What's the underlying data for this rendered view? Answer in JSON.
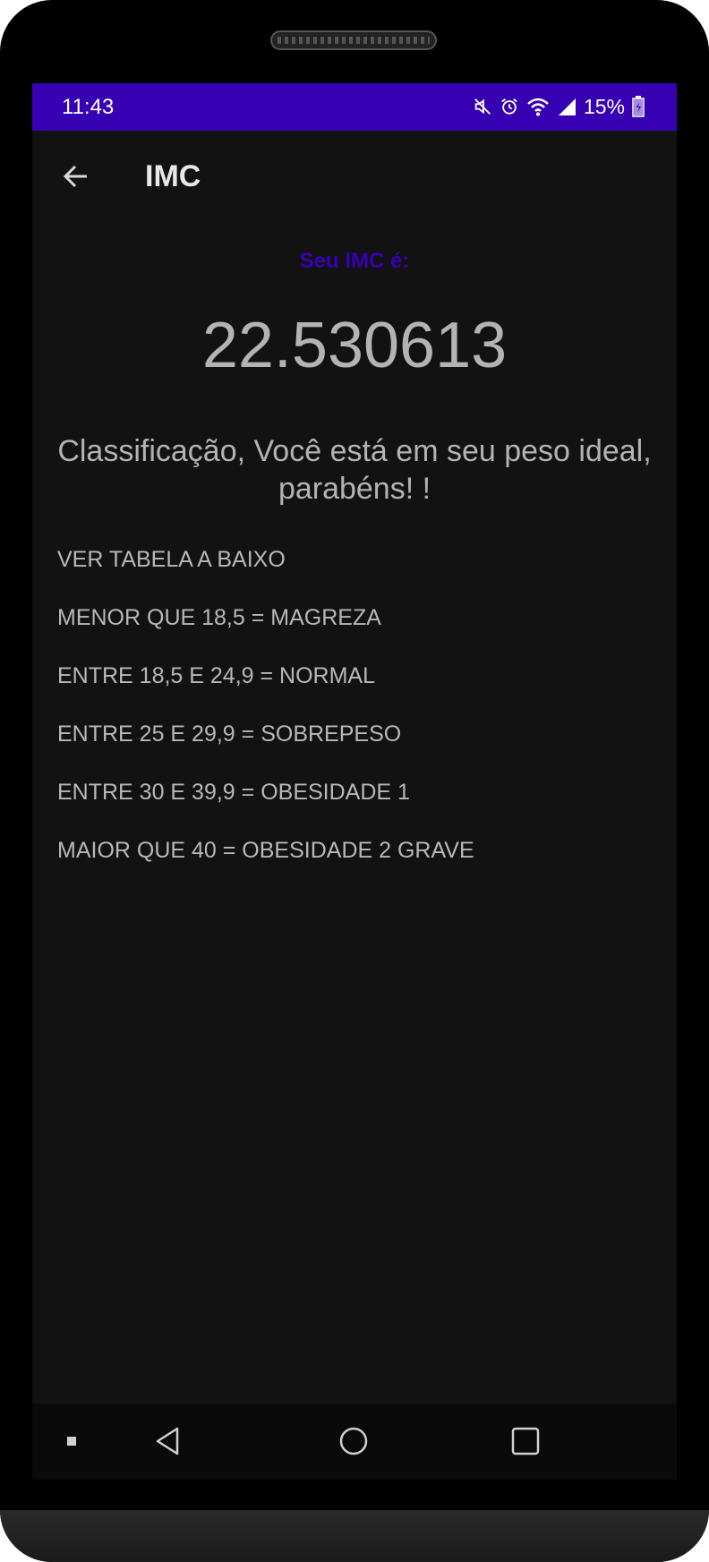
{
  "status_bar": {
    "time": "11:43",
    "battery_percent": "15%",
    "icons": [
      "mute-icon",
      "alarm-icon",
      "wifi-icon",
      "signal-icon",
      "battery-charging-icon"
    ]
  },
  "toolbar": {
    "title": "IMC",
    "back_icon": "arrow-left-icon"
  },
  "result": {
    "label": "Seu IMC é:",
    "value": "22.530613",
    "classification": "Classificação, Você está em seu peso ideal, parabéns! !"
  },
  "table": {
    "lines": [
      "VER TABELA A BAIXO",
      "MENOR QUE 18,5 = MAGREZA",
      "ENTRE 18,5 E 24,9 = NORMAL",
      "ENTRE 25 E 29,9 = SOBREPESO",
      "ENTRE 30 E 39,9 = OBESIDADE 1",
      "MAIOR QUE 40 = OBESIDADE 2 GRAVE"
    ]
  },
  "nav_bar": {
    "icons": [
      "recents-dot-icon",
      "back-triangle-icon",
      "home-circle-icon",
      "overview-square-icon"
    ]
  },
  "colors": {
    "status_bar": "#3700b3",
    "accent_label": "#3700b3",
    "background": "#121212",
    "text": "#b3b3b3"
  }
}
